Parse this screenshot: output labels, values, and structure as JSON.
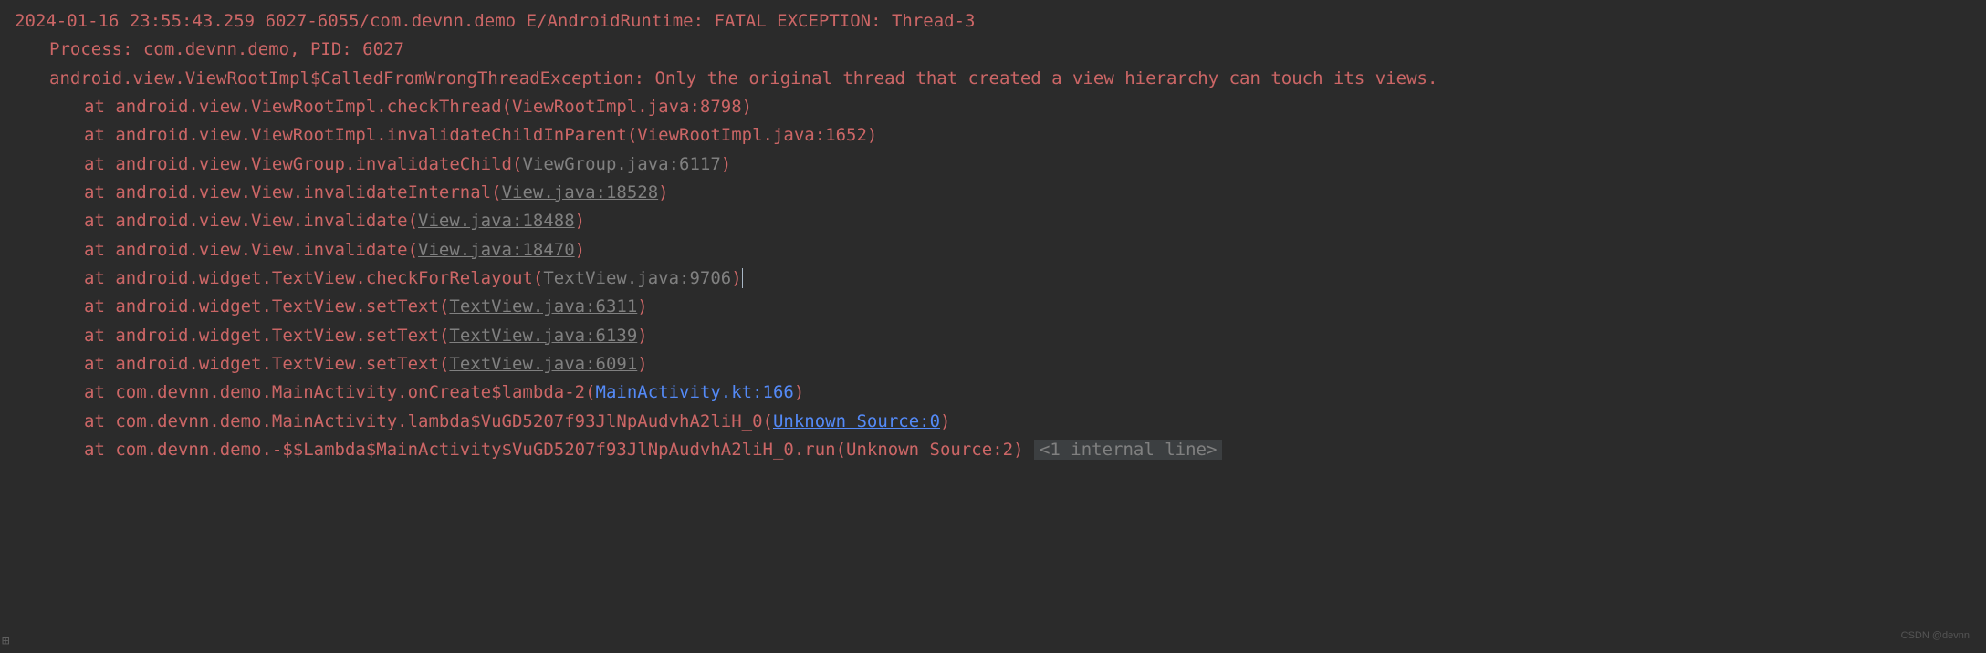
{
  "header": {
    "timestamp": "2024-01-16 23:55:43.259",
    "pidtid": "6027-6055",
    "package": "com.devnn.demo",
    "tag": "E/AndroidRuntime:",
    "message": "FATAL EXCEPTION: Thread-3"
  },
  "process": "Process: com.devnn.demo, PID: 6027",
  "exception": "android.view.ViewRootImpl$CalledFromWrongThreadException: Only the original thread that created a view hierarchy can touch its views.",
  "stack": [
    {
      "at": "at android.view.ViewRootImpl.checkThread(ViewRootImpl.java:8798)",
      "link": null
    },
    {
      "at": "at android.view.ViewRootImpl.invalidateChildInParent(ViewRootImpl.java:1652)",
      "link": null
    },
    {
      "pre": "at android.view.ViewGroup.invalidateChild(",
      "link": "ViewGroup.java:6117",
      "post": ")",
      "linkType": "gray"
    },
    {
      "pre": "at android.view.View.invalidateInternal(",
      "link": "View.java:18528",
      "post": ")",
      "linkType": "gray"
    },
    {
      "pre": "at android.view.View.invalidate(",
      "link": "View.java:18488",
      "post": ")",
      "linkType": "gray"
    },
    {
      "pre": "at android.view.View.invalidate(",
      "link": "View.java:18470",
      "post": ")",
      "linkType": "gray"
    },
    {
      "pre": "at android.widget.TextView.checkForRelayout(",
      "link": "TextView.java:9706",
      "post": ")",
      "linkType": "gray",
      "cursor": true
    },
    {
      "pre": "at android.widget.TextView.setText(",
      "link": "TextView.java:6311",
      "post": ")",
      "linkType": "gray"
    },
    {
      "pre": "at android.widget.TextView.setText(",
      "link": "TextView.java:6139",
      "post": ")",
      "linkType": "gray"
    },
    {
      "pre": "at android.widget.TextView.setText(",
      "link": "TextView.java:6091",
      "post": ")",
      "linkType": "gray"
    },
    {
      "pre": "at com.devnn.demo.MainActivity.onCreate$lambda-2(",
      "link": "MainActivity.kt:166",
      "post": ")",
      "linkType": "blue"
    },
    {
      "pre": "at com.devnn.demo.MainActivity.lambda$VuGD5207f93JlNpAudvhA2liH_0(",
      "link": "Unknown Source:0",
      "post": ")",
      "linkType": "blue"
    },
    {
      "at": "at com.devnn.demo.-$$Lambda$MainActivity$VuGD5207f93JlNpAudvhA2liH_0.run(Unknown Source:2)",
      "internal": "<1 internal line>"
    }
  ],
  "expandIcon": "⊞",
  "watermark": "CSDN @devnn"
}
